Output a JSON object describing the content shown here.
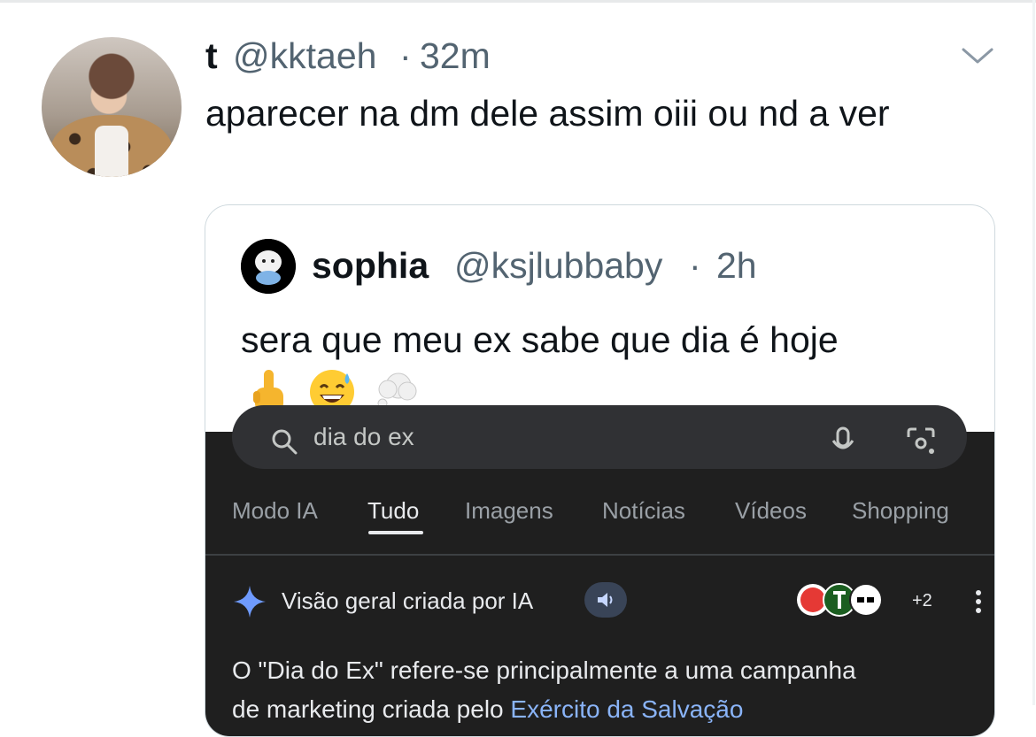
{
  "tweet": {
    "display_name": "t",
    "handle": "@kktaeh",
    "separator": "·",
    "time": "32m",
    "text": "aparecer na dm dele assim oiii ou nd a ver"
  },
  "quoted_tweet": {
    "display_name": "sophia",
    "handle": "@ksjlubbaby",
    "separator": "·",
    "time": "2h",
    "text": "sera que meu ex sabe que dia é hoje",
    "emojis": [
      "point-up-emoji",
      "sweat-smile-emoji",
      "thought-balloon-emoji"
    ]
  },
  "embedded_screenshot": {
    "search_query": "dia do ex",
    "tabs": [
      "Modo IA",
      "Tudo",
      "Imagens",
      "Notícias",
      "Vídeos",
      "Shopping"
    ],
    "active_tab": "Tudo",
    "ai_overview_label": "Visão geral criada por IA",
    "sources_more": "+2",
    "answer_text_line1": "O \"Dia do Ex\" refere-se principalmente a uma campanha",
    "answer_text_line2_prefix": "de marketing criada pelo ",
    "answer_text_line2_link": "Exército da Salvação",
    "colors": {
      "background": "#1f1f1f",
      "link": "#8ab4f8",
      "text": "#e8eaed"
    }
  }
}
